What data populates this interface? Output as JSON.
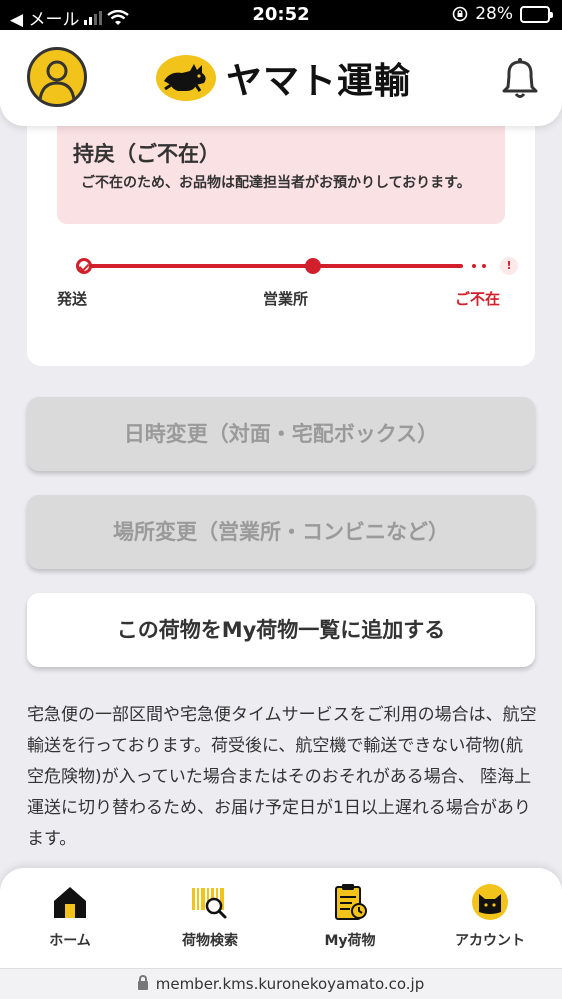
{
  "status_bar": {
    "back_carrier": "◀ メール",
    "time": "20:52",
    "battery": "28%"
  },
  "header": {
    "logo_text": "ヤマト運輸",
    "logo_color": "#f2c31a"
  },
  "notice": {
    "title": "持戻（ご不在）",
    "body": "ご不在のため、お品物は配達担当者がお預かりしております。"
  },
  "progress": {
    "steps": [
      {
        "label": "発送"
      },
      {
        "label": "営業所"
      },
      {
        "label": "ご不在"
      }
    ],
    "end_mark": "!",
    "accent": "#d11f2b"
  },
  "buttons": {
    "change_datetime": "日時変更（対面・宅配ボックス）",
    "change_place": "場所変更（営業所・コンビニなど）",
    "add_to_list": "この荷物をMy荷物一覧に追加する"
  },
  "info_text": "宅急便の一部区間や宅急便タイムサービスをご利用の場合は、航空輸送を行っております。荷受後に、航空機で輸送できない荷物(航空危険物)が入っていた場合またはそのおそれがある場合、 陸海上運送に切り替わるため、お届け予定日が1日以上遅れる場合があります。",
  "tabbar": {
    "items": [
      {
        "label": "ホーム",
        "icon": "home-icon"
      },
      {
        "label": "荷物検索",
        "icon": "barcode-search-icon"
      },
      {
        "label": "My荷物",
        "icon": "clipboard-icon"
      },
      {
        "label": "アカウント",
        "icon": "cat-account-icon"
      }
    ]
  },
  "url": "member.kms.kuronekoyamato.co.jp"
}
